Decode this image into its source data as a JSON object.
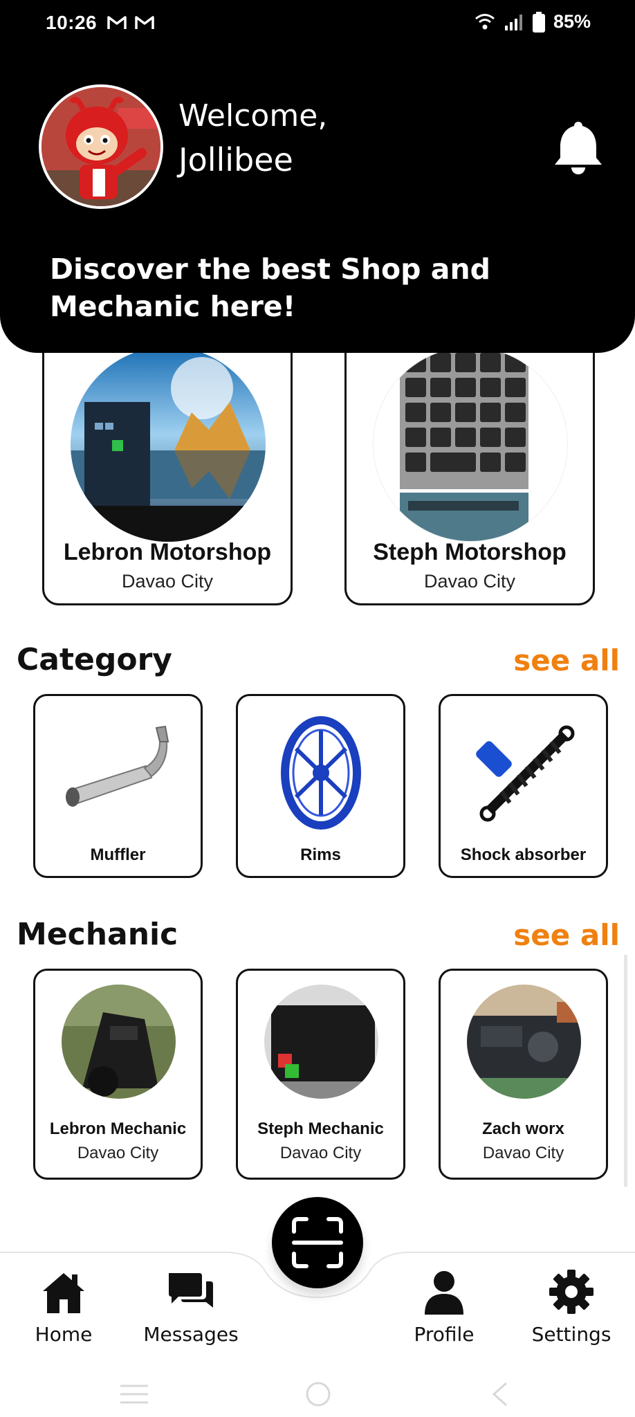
{
  "status_bar": {
    "time": "10:26",
    "battery_pct": "85%",
    "icons": [
      "gmail-icon",
      "gmail-icon",
      "wifi-icon",
      "signal-icon",
      "battery-icon"
    ]
  },
  "header": {
    "greeting": "Welcome,",
    "user_name": "Jollibee",
    "tagline": "Discover the best Shop and Mechanic here!",
    "notification_icon": "bell-icon"
  },
  "shops": [
    {
      "name": "Lebron Motorshop",
      "location": "Davao City"
    },
    {
      "name": "Steph Motorshop",
      "location": "Davao City"
    }
  ],
  "category": {
    "title": "Category",
    "see_all": "see all",
    "items": [
      {
        "label": "Muffler"
      },
      {
        "label": "Rims"
      },
      {
        "label": "Shock absorber"
      }
    ]
  },
  "mechanic": {
    "title": "Mechanic",
    "see_all": "see all",
    "items": [
      {
        "name": "Lebron Mechanic",
        "location": "Davao City"
      },
      {
        "name": "Steph Mechanic",
        "location": "Davao City"
      },
      {
        "name": "Zach worx",
        "location": "Davao City"
      }
    ]
  },
  "bottom_nav": {
    "home": "Home",
    "messages": "Messages",
    "profile": "Profile",
    "settings": "Settings",
    "scan_icon": "scan-icon"
  },
  "colors": {
    "header_bg": "#000000",
    "accent": "#f08010",
    "card_border": "#111111"
  }
}
